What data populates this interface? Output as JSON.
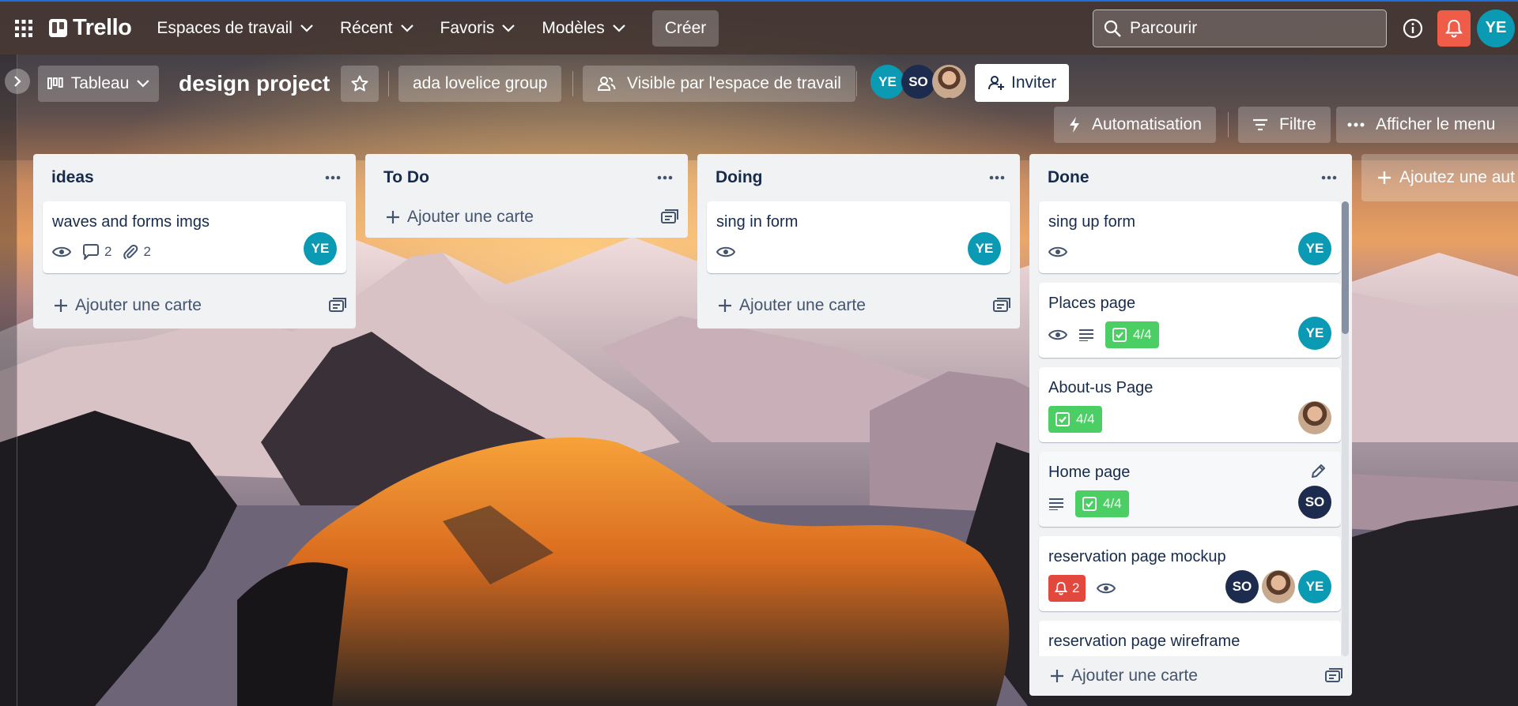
{
  "nav": {
    "app_name": "Trello",
    "workspaces_label": "Espaces de travail",
    "recent_label": "Récent",
    "favorites_label": "Favoris",
    "templates_label": "Modèles",
    "create_label": "Créer",
    "search_placeholder": "Parcourir",
    "user_initials": "YE"
  },
  "board": {
    "view_label": "Tableau",
    "title": "design project",
    "workspace_label": "ada lovelice group",
    "visibility_label": "Visible par l'espace de travail",
    "members": [
      {
        "initials": "YE",
        "color": "#0a9ab4"
      },
      {
        "initials": "SO",
        "color": "#1d2b4e"
      },
      {
        "initials": "",
        "color": "photo"
      }
    ],
    "invite_label": "Inviter",
    "automation_label": "Automatisation",
    "filter_label": "Filtre",
    "menu_label": "Afficher le menu",
    "add_list_label": "Ajoutez une aut"
  },
  "lists": [
    {
      "title": "ideas",
      "add_card_label": "Ajouter une carte",
      "cards": [
        {
          "title": "waves and forms imgs",
          "comments": "2",
          "attachments": "2",
          "avatars": [
            "YE"
          ]
        }
      ]
    },
    {
      "title": "To Do",
      "add_card_label": "Ajouter une carte",
      "cards": []
    },
    {
      "title": "Doing",
      "add_card_label": "Ajouter une carte",
      "cards": [
        {
          "title": "sing in form",
          "avatars": [
            "YE"
          ]
        }
      ]
    },
    {
      "title": "Done",
      "add_card_label": "Ajouter une carte",
      "cards": [
        {
          "title": "sing up form",
          "avatars": [
            "YE"
          ]
        },
        {
          "title": "Places page",
          "checklist": "4/4",
          "avatars": [
            "YE"
          ]
        },
        {
          "title": "About-us Page",
          "checklist": "4/4",
          "avatars": [
            "photo"
          ]
        },
        {
          "title": "Home page",
          "checklist": "4/4",
          "avatars": [
            "SO"
          ]
        },
        {
          "title": "reservation page mockup",
          "due_count": "2",
          "avatars": [
            "SO",
            "photo",
            "YE"
          ]
        },
        {
          "title": "reservation page wireframe",
          "avatars": []
        }
      ]
    }
  ],
  "colors": {
    "accent_green": "#4bce63",
    "alert_red": "#e2483d",
    "avatar_teal": "#0a9ab4",
    "avatar_navy": "#1d2b4e",
    "notification_red": "#ef5c48"
  }
}
